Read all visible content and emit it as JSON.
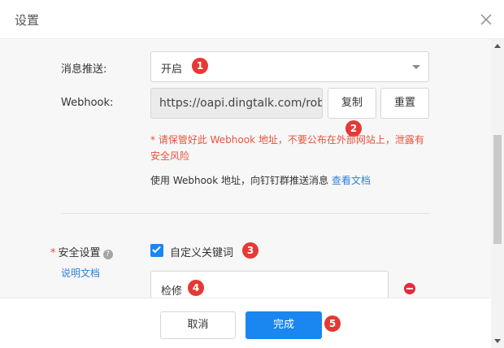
{
  "dialog": {
    "title": "设置"
  },
  "form": {
    "push": {
      "label": "消息推送:",
      "value": "开启"
    },
    "webhook": {
      "label": "Webhook:",
      "value": "https://oapi.dingtalk.com/robot/send?access_token=",
      "copy_label": "复制",
      "reset_label": "重置",
      "warning": "* 请保管好此 Webhook 地址，不要公布在外部网站上，泄露有安全风险",
      "info": "使用 Webhook 地址，向钉钉群推送消息",
      "doc_link": "查看文档"
    },
    "security": {
      "required_mark": "*",
      "label": "安全设置",
      "help_icon": "question-icon",
      "doc_link": "说明文档",
      "keyword_checkbox_label": "自定义关键词",
      "keyword_checked": true,
      "keyword_value": "检修"
    }
  },
  "footer": {
    "cancel_label": "取消",
    "ok_label": "完成"
  },
  "markers": [
    "1",
    "2",
    "3",
    "4",
    "5"
  ],
  "colors": {
    "primary": "#1a86f0",
    "warning_text": "#e8533e",
    "link": "#2d7fd8",
    "marker": "#e53935",
    "remove": "#e8283c"
  }
}
